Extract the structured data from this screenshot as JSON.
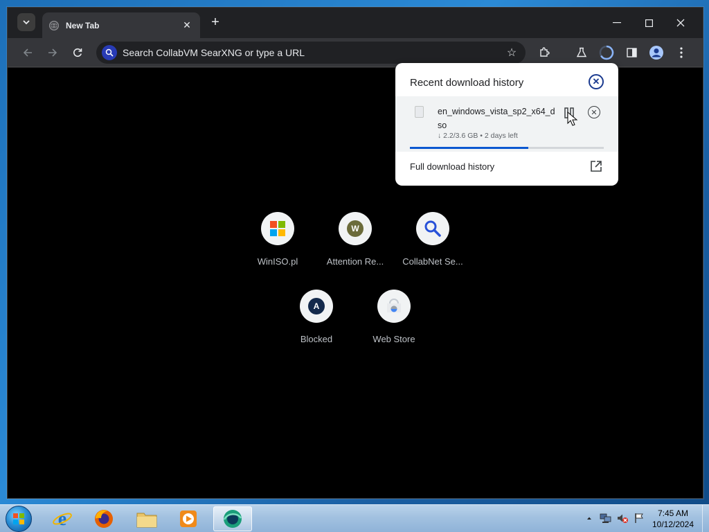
{
  "browser": {
    "tab": {
      "title": "New Tab",
      "favicon": "globe-icon"
    },
    "omnibox": {
      "placeholder": "Search CollabVM SearXNG or type a URL"
    },
    "icons": [
      "back-icon",
      "forward-icon",
      "reload-icon",
      "star-icon",
      "extensions-icon",
      "labs-icon",
      "downloads-icon",
      "side-panel-icon",
      "profile-icon",
      "menu-icon"
    ]
  },
  "shortcuts": [
    {
      "label": "WinISO.pl",
      "icon": "windows-logo-icon"
    },
    {
      "label": "Attention Re...",
      "icon": "letter-w-icon",
      "letter": "W"
    },
    {
      "label": "CollabNet Se...",
      "icon": "search-icon"
    },
    {
      "label": "Blocked",
      "icon": "letter-a-icon",
      "letter": "A"
    },
    {
      "label": "Web Store",
      "icon": "web-store-icon"
    }
  ],
  "downloads": {
    "title": "Recent download history",
    "item": {
      "filename": "en_windows_vista_sp2_x64_d\nso",
      "status": "↓ 2.2/3.6 GB • 2 days left",
      "progress": 0.61
    },
    "full_history": "Full download history"
  },
  "taskbar": {
    "apps": [
      "internet-explorer-icon",
      "firefox-icon",
      "file-explorer-icon",
      "media-player-icon",
      "collabvm-icon"
    ],
    "clock": {
      "time": "7:45 AM",
      "date": "10/12/2024"
    }
  },
  "colors": {
    "accent": "#0b57d0",
    "panel_close": "#1a3a8f",
    "omnibox_icon": "#283bb5"
  }
}
